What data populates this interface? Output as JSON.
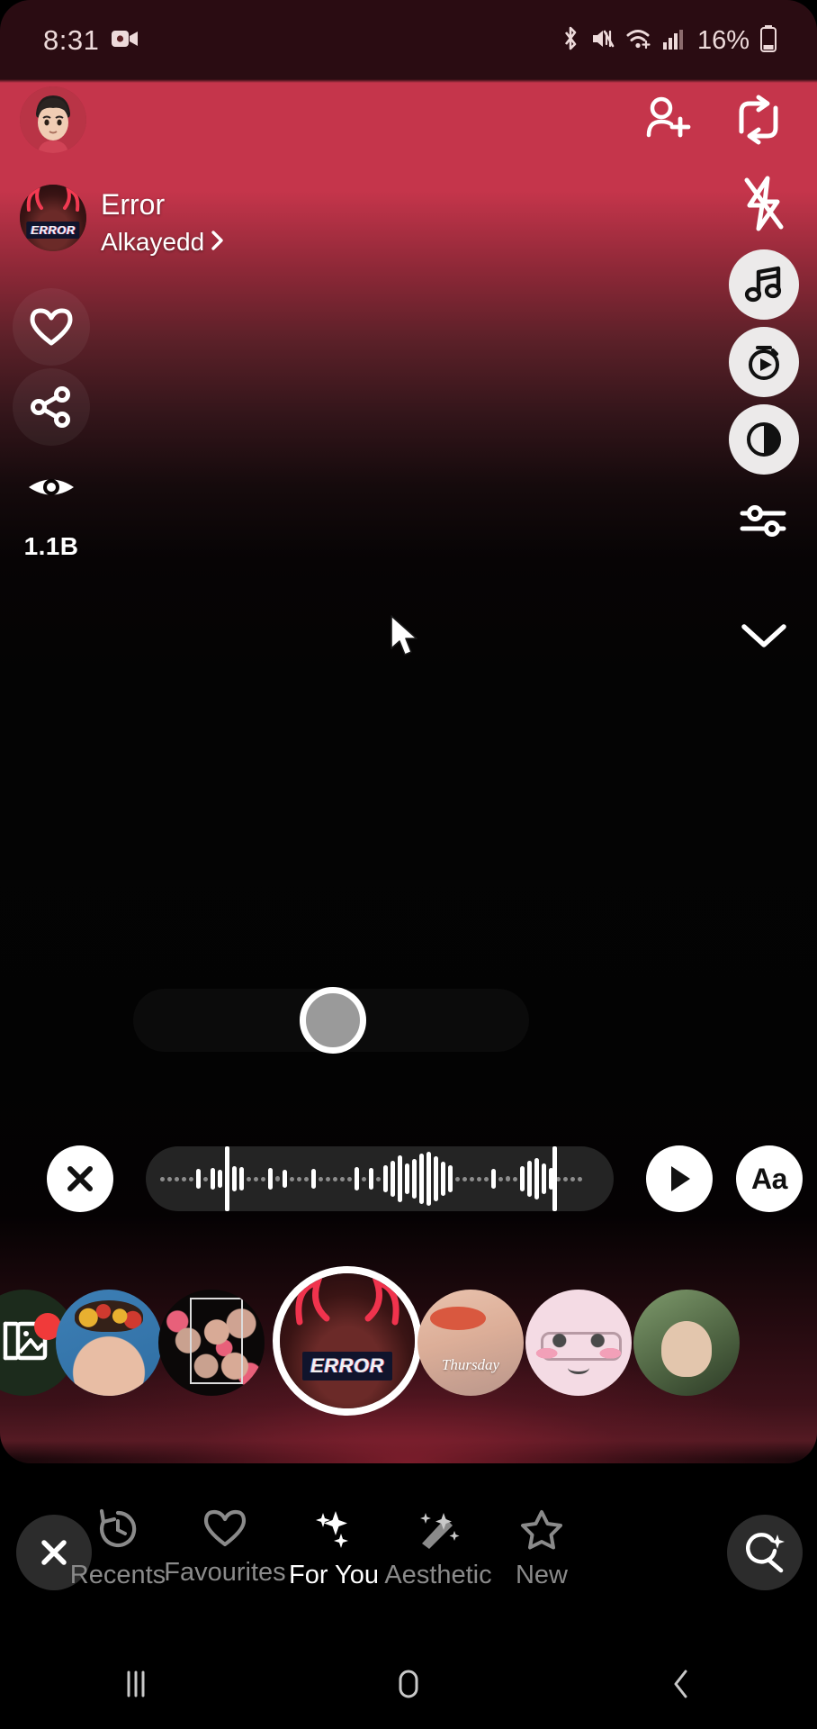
{
  "status_bar": {
    "time": "8:31",
    "battery_percent": "16%",
    "icons": [
      "video-record-icon",
      "bluetooth-icon",
      "mute-icon",
      "wifi-icon",
      "cellular-signal-icon",
      "battery-icon"
    ]
  },
  "top_bar": {
    "avatar_name": "bitmoji-avatar",
    "add_friend_label": "add-friend",
    "flip_camera_label": "flip-camera"
  },
  "lens_info": {
    "title": "Error",
    "author": "Alkayedd",
    "chevron": "›",
    "thumb_tag": "ERROR"
  },
  "left_rail": {
    "favourite_label": "favourite",
    "share_label": "share",
    "views_label": "views",
    "view_count": "1.1B"
  },
  "right_rail": {
    "items": [
      {
        "name": "flip-camera-icon",
        "style": "plain"
      },
      {
        "name": "flash-off-icon",
        "style": "plain"
      },
      {
        "name": "music-note-icon",
        "style": "circle"
      },
      {
        "name": "timer-speed-icon",
        "style": "circle"
      },
      {
        "name": "tone-contrast-icon",
        "style": "circle"
      },
      {
        "name": "settings-sliders-icon",
        "style": "plain"
      },
      {
        "name": "chevron-down-icon",
        "style": "plain"
      }
    ]
  },
  "capture": {
    "shutter_label": "capture"
  },
  "audio_bar": {
    "close_label": "✕",
    "play_label": "play",
    "text_label": "Aa",
    "waveform_bars": [
      3,
      4,
      3,
      3,
      0,
      22,
      5,
      24,
      20,
      7,
      28,
      26,
      5,
      4,
      5,
      24,
      6,
      20,
      5,
      5,
      4,
      22,
      5,
      5,
      5,
      4,
      5,
      26,
      5,
      24,
      5,
      30,
      40,
      52,
      34,
      44,
      56,
      60,
      50,
      38,
      30,
      5,
      5,
      5,
      4,
      5,
      22,
      5,
      6,
      5,
      28,
      40,
      46,
      34,
      24,
      5,
      4,
      3,
      4
    ],
    "trim_start_pct": 17,
    "trim_end_pct": 87
  },
  "carousel": {
    "gallery_label": "gallery",
    "gallery_has_badge": true,
    "lenses": [
      {
        "name": "lens-boy-flowers",
        "art": "art-boy",
        "label": ""
      },
      {
        "name": "lens-cats-grid",
        "art": "art-cats",
        "label": ""
      },
      {
        "name": "lens-error-selected",
        "art": "art-error",
        "label": "ERROR",
        "selected": true
      },
      {
        "name": "lens-lips-thursday",
        "art": "art-lips",
        "label": "Thursday"
      },
      {
        "name": "lens-pink-glasses",
        "art": "art-pink",
        "label": ""
      },
      {
        "name": "lens-green-partial",
        "art": "art-green",
        "label": ""
      }
    ]
  },
  "bottom_nav": {
    "close_label": "✕",
    "items": [
      {
        "label": "Recents",
        "icon": "history-icon",
        "active": false
      },
      {
        "label": "Favourites",
        "icon": "heart-icon",
        "active": false
      },
      {
        "label": "For You",
        "icon": "sparkles-icon",
        "active": true
      },
      {
        "label": "Aesthetic",
        "icon": "magic-wand-icon",
        "active": false
      },
      {
        "label": "New",
        "icon": "star-icon",
        "active": false
      }
    ],
    "search_label": "search-lenses"
  },
  "android_nav": {
    "recents_label": "recent-apps",
    "home_label": "home",
    "back_label": "back"
  },
  "colors": {
    "accent_red": "#c5354b",
    "active_white": "#ffffff",
    "inactive_grey": "#8a8a8a"
  }
}
